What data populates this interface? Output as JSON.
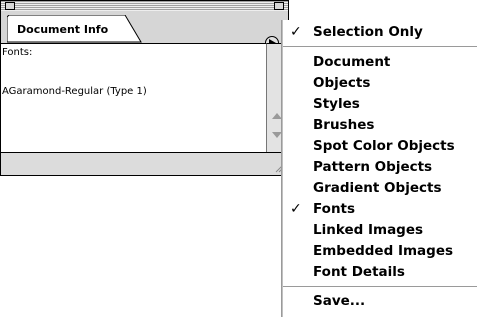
{
  "palette": {
    "tab_label": "Document Info",
    "content_lines": [
      "Fonts:",
      "AGaramond-Regular (Type 1)"
    ]
  },
  "menu": {
    "items": [
      {
        "label": "Selection Only",
        "checked": true
      },
      {
        "label": "Document",
        "checked": false
      },
      {
        "label": "Objects",
        "checked": false
      },
      {
        "label": "Styles",
        "checked": false
      },
      {
        "label": "Brushes",
        "checked": false
      },
      {
        "label": "Spot Color Objects",
        "checked": false
      },
      {
        "label": "Pattern Objects",
        "checked": false
      },
      {
        "label": "Gradient Objects",
        "checked": false
      },
      {
        "label": "Fonts",
        "checked": true
      },
      {
        "label": "Linked Images",
        "checked": false
      },
      {
        "label": "Embedded Images",
        "checked": false
      },
      {
        "label": "Font Details",
        "checked": false
      },
      {
        "label": "Save...",
        "checked": false
      }
    ],
    "check_glyph": "✓"
  }
}
